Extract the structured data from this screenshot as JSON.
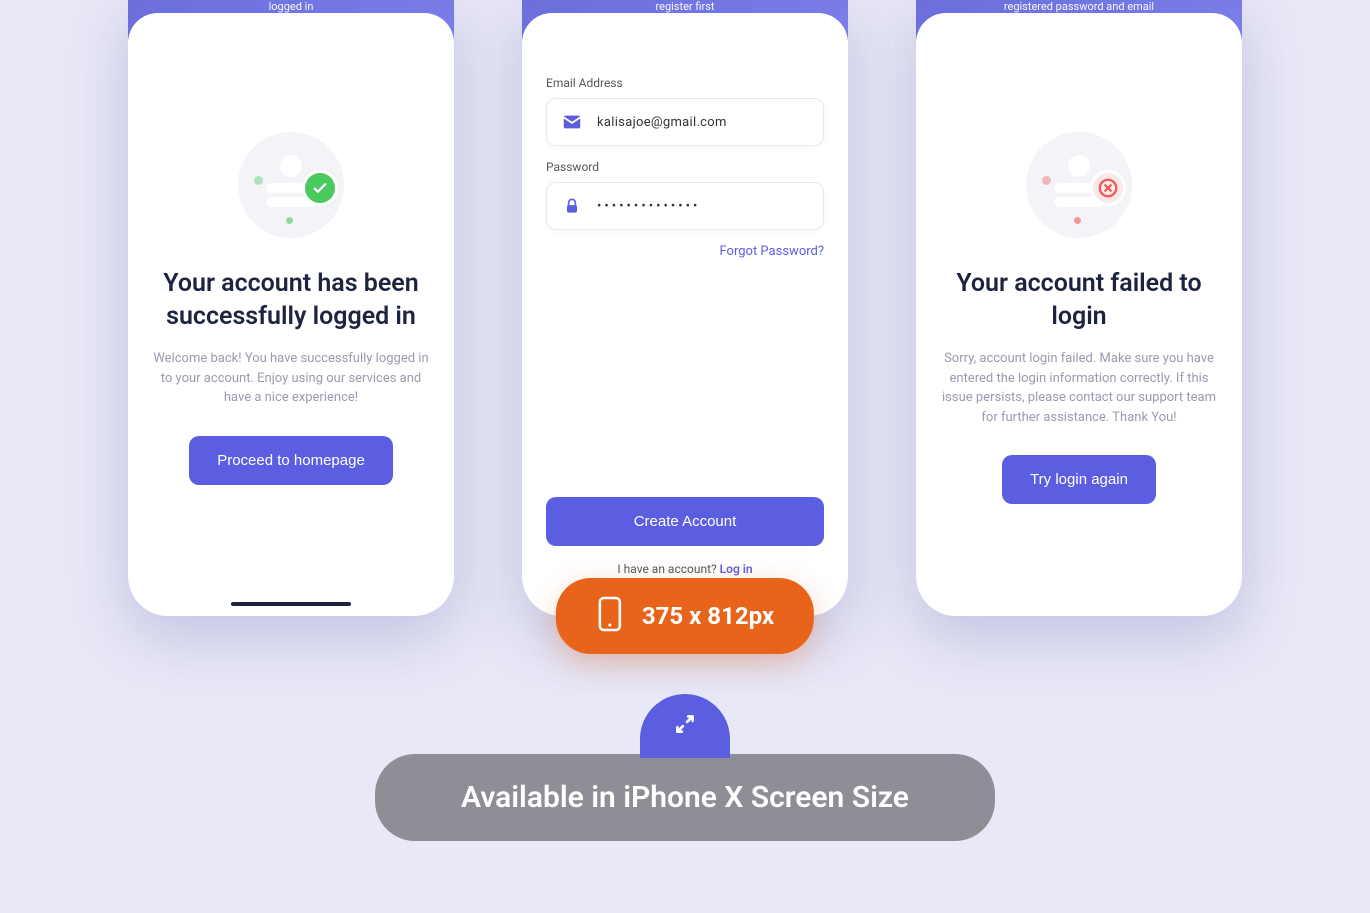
{
  "screen1": {
    "header_text": "logged in",
    "title": "Your account has been successfully logged in",
    "subtitle": "Welcome back! You have successfully logged in to your account. Enjoy using our services and have a nice experience!",
    "button": "Proceed to homepage"
  },
  "screen2": {
    "header_text": "register first",
    "email_label": "Email Address",
    "email_value": "kalisajoe@gmail.com",
    "password_label": "Password",
    "password_value": "••••••••••••••",
    "forgot_link": "Forgot Password?",
    "create_button": "Create Account",
    "footer_prompt": "I have an account? ",
    "footer_link": "Log in"
  },
  "screen3": {
    "header_text": "registered password and email",
    "title": "Your account failed to login",
    "subtitle": "Sorry, account login failed. Make sure you have entered the login information correctly. If this issue persists, please contact our support team for further assistance. Thank You!",
    "button": "Try login again"
  },
  "size_badge": "375 x 812px",
  "bottom_text": "Available in iPhone X Screen Size"
}
